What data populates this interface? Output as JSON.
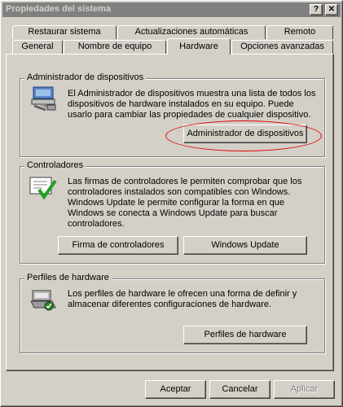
{
  "window": {
    "title": "Propiedades del sistema"
  },
  "titlebar": {
    "help_label": "?",
    "close_label": "✕"
  },
  "tabs_back": [
    "Restaurar sistema",
    "Actualizaciones automáticas",
    "Remoto"
  ],
  "tabs_front": [
    "General",
    "Nombre de equipo",
    "Hardware",
    "Opciones avanzadas"
  ],
  "active_tab": "Hardware",
  "device_manager": {
    "title": "Administrador de dispositivos",
    "description": "El Administrador de dispositivos muestra una lista de todos los dispositivos de hardware instalados en su equipo. Puede usarlo para cambiar las propiedades de cualquier dispositivo.",
    "button": "Administrador de dispositivos",
    "icon": "device-manager-icon"
  },
  "drivers": {
    "title": "Controladores",
    "description": "Las firmas de controladores le permiten comprobar que los controladores instalados son compatibles con Windows. Windows Update le permite configurar la forma en que Windows se conecta a Windows Update para buscar controladores.",
    "signing_button": "Firma de controladores",
    "update_button": "Windows Update",
    "icon": "driver-signing-icon"
  },
  "hardware_profiles": {
    "title": "Perfiles de hardware",
    "description": "Los perfiles de hardware le ofrecen una forma de definir y almacenar diferentes configuraciones de hardware.",
    "button": "Perfiles de hardware",
    "icon": "hardware-profile-icon"
  },
  "dialog_buttons": {
    "ok": "Aceptar",
    "cancel": "Cancelar",
    "apply": "Aplicar"
  },
  "colors": {
    "face": "#d4d0c8",
    "inactive_title": "#808080",
    "annotation": "#e00000"
  }
}
